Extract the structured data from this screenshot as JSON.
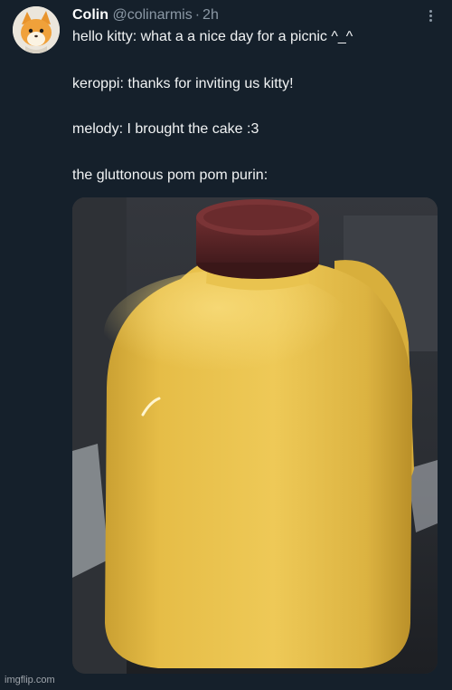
{
  "tweet": {
    "author_name": "Colin",
    "author_handle": "@colinarmis",
    "separator": "·",
    "timestamp": "2h",
    "lines": [
      "hello kitty: what a a nice day for a picnic ^_^",
      "keroppi: thanks for inviting us kitty!",
      "melody: I brought the cake :3",
      "the gluttonous pom pom purin:"
    ],
    "media_description_icon": "milk-jug-photo",
    "more_icon": "more-dots-icon"
  },
  "watermark": "imgflip.com",
  "colors": {
    "background": "#15202b",
    "jug": "#e9c04a",
    "cap": "#5a2426"
  }
}
